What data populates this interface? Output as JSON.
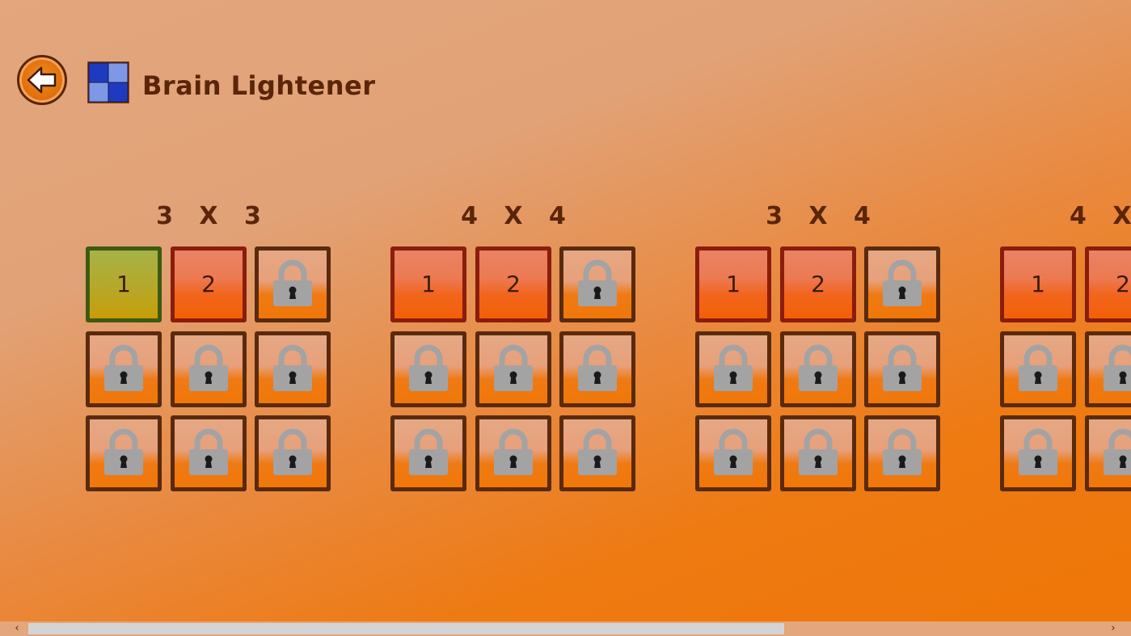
{
  "header": {
    "title": "Brain Lightener",
    "back_icon": "arrow-left-icon",
    "logo_icon": "checker-grid-logo-icon",
    "logo_colors": [
      "#1e3bbf",
      "#7f98e6"
    ]
  },
  "level_groups": [
    {
      "title": "3 X 3",
      "tiles": [
        {
          "label": "1",
          "state": "completed"
        },
        {
          "label": "2",
          "state": "available"
        },
        {
          "label": "",
          "state": "locked"
        },
        {
          "label": "",
          "state": "locked"
        },
        {
          "label": "",
          "state": "locked"
        },
        {
          "label": "",
          "state": "locked"
        },
        {
          "label": "",
          "state": "locked"
        },
        {
          "label": "",
          "state": "locked"
        },
        {
          "label": "",
          "state": "locked"
        }
      ]
    },
    {
      "title": "4 X 4",
      "tiles": [
        {
          "label": "1",
          "state": "available"
        },
        {
          "label": "2",
          "state": "available"
        },
        {
          "label": "",
          "state": "locked"
        },
        {
          "label": "",
          "state": "locked"
        },
        {
          "label": "",
          "state": "locked"
        },
        {
          "label": "",
          "state": "locked"
        },
        {
          "label": "",
          "state": "locked"
        },
        {
          "label": "",
          "state": "locked"
        },
        {
          "label": "",
          "state": "locked"
        }
      ]
    },
    {
      "title": "3 X 4",
      "tiles": [
        {
          "label": "1",
          "state": "available"
        },
        {
          "label": "2",
          "state": "available"
        },
        {
          "label": "",
          "state": "locked"
        },
        {
          "label": "",
          "state": "locked"
        },
        {
          "label": "",
          "state": "locked"
        },
        {
          "label": "",
          "state": "locked"
        },
        {
          "label": "",
          "state": "locked"
        },
        {
          "label": "",
          "state": "locked"
        },
        {
          "label": "",
          "state": "locked"
        }
      ]
    },
    {
      "title": "4 X",
      "tiles": [
        {
          "label": "1",
          "state": "available"
        },
        {
          "label": "2",
          "state": "available"
        },
        {
          "label": "",
          "state": "locked"
        },
        {
          "label": "",
          "state": "locked"
        },
        {
          "label": "",
          "state": "locked"
        },
        {
          "label": "",
          "state": "locked"
        },
        {
          "label": "",
          "state": "locked"
        },
        {
          "label": "",
          "state": "locked"
        },
        {
          "label": "",
          "state": "locked"
        }
      ]
    }
  ],
  "scrollbar": {
    "left_arrow": "‹",
    "right_arrow": "›"
  },
  "colors": {
    "text": "#5a2508",
    "locked_border": "#5a2a0e",
    "available_border": "#8a1d0c",
    "completed_border": "#3e5a10",
    "lock_body": "#a3a3a3"
  }
}
